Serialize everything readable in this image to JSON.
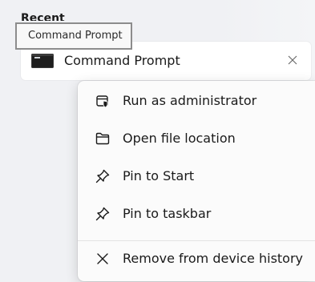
{
  "section": {
    "heading": "Recent"
  },
  "recent_item": {
    "label": "Command Prompt",
    "icon": "command-prompt-icon",
    "remove_icon": "close-icon"
  },
  "tooltip": {
    "text": "Command Prompt"
  },
  "context_menu": {
    "items": [
      {
        "label": "Run as administrator",
        "icon": "shield-admin-icon"
      },
      {
        "label": "Open file location",
        "icon": "folder-icon"
      },
      {
        "label": "Pin to Start",
        "icon": "pin-icon"
      },
      {
        "label": "Pin to taskbar",
        "icon": "pin-icon"
      },
      {
        "label": "Remove from device history",
        "icon": "close-icon"
      }
    ]
  }
}
